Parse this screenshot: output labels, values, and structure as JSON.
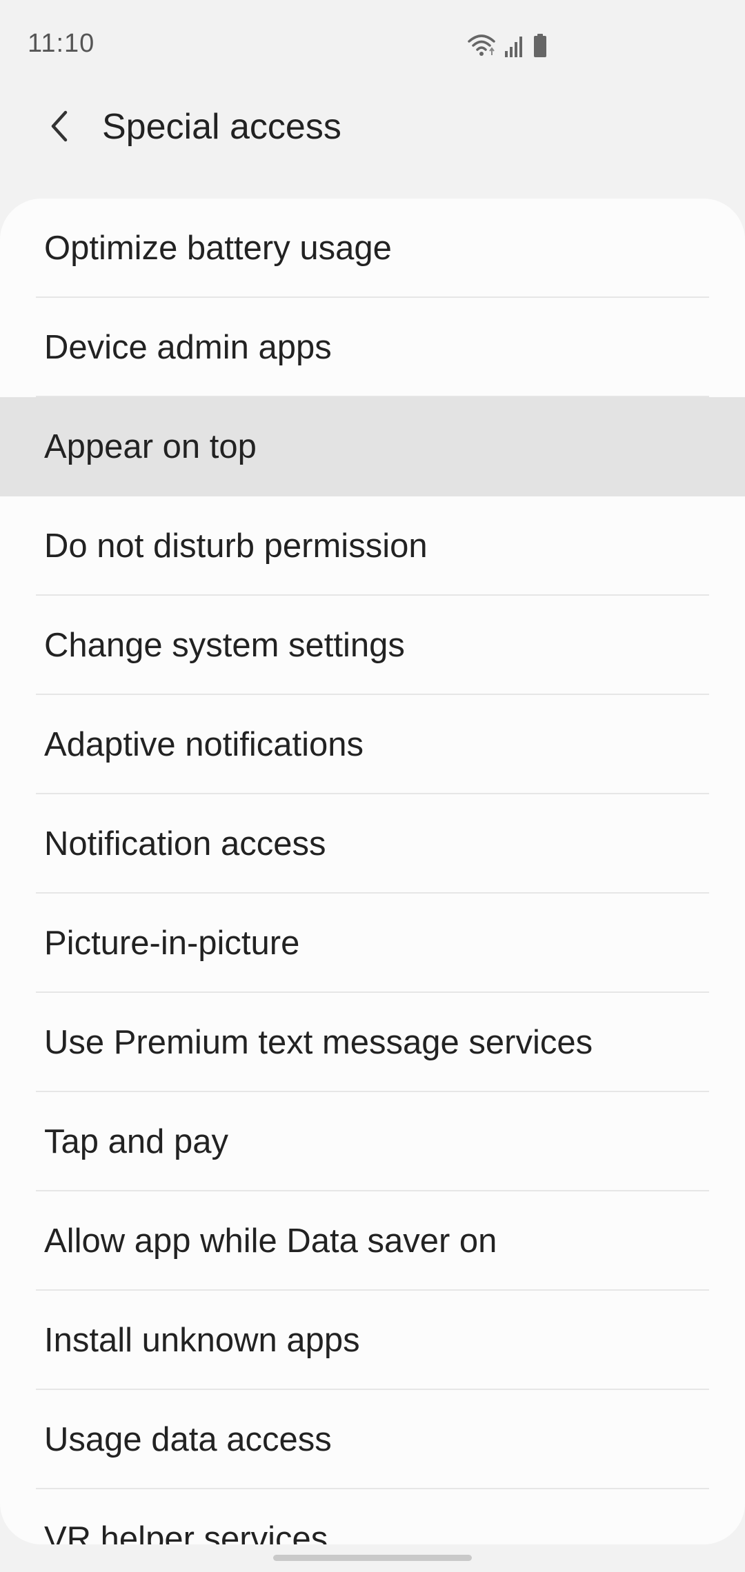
{
  "status_bar": {
    "time": "11:10",
    "icons": [
      "wifi-icon",
      "signal-icon",
      "battery-icon"
    ]
  },
  "header": {
    "back_icon": "chevron-left-icon",
    "title": "Special access"
  },
  "list": {
    "highlighted_index": 2,
    "items": [
      {
        "label": "Optimize battery usage"
      },
      {
        "label": "Device admin apps"
      },
      {
        "label": "Appear on top"
      },
      {
        "label": "Do not disturb permission"
      },
      {
        "label": "Change system settings"
      },
      {
        "label": "Adaptive notifications"
      },
      {
        "label": "Notification access"
      },
      {
        "label": "Picture-in-picture"
      },
      {
        "label": "Use Premium text message services"
      },
      {
        "label": "Tap and pay"
      },
      {
        "label": "Allow app while Data saver on"
      },
      {
        "label": "Install unknown apps"
      },
      {
        "label": "Usage data access"
      },
      {
        "label": "VR helper services"
      }
    ]
  },
  "colors": {
    "background": "#f2f2f2",
    "card": "#fcfcfc",
    "highlight": "#e3e3e3",
    "divider": "#e6e6e6",
    "text": "#222222"
  }
}
